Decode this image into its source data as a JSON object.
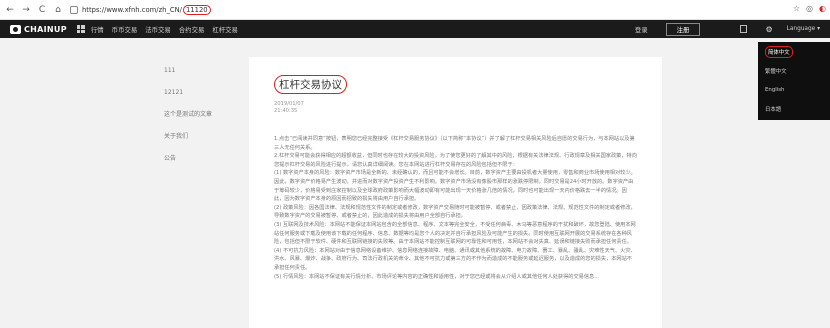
{
  "browser": {
    "nav_back": "←",
    "nav_forward": "→",
    "nav_reload": "C",
    "nav_home": "⌂",
    "url_base": "https://www.xfnh.com/zh_CN/",
    "url_id": "11120",
    "right_icons": [
      "☆",
      "◎",
      "◐"
    ],
    "accent_color": "#e01e1e"
  },
  "topnav": {
    "brand": "CHAINUP",
    "menu": [
      "行情",
      "币币交易",
      "法币交易",
      "合约交易",
      "杠杆交易"
    ],
    "login": "登录",
    "register": "注册",
    "language_label": "Language ▾"
  },
  "language_menu": {
    "items": [
      "简体中文",
      "繁體中文",
      "English",
      "日本語"
    ],
    "selected_index": 0
  },
  "sidebar": {
    "items": [
      "111",
      "12121",
      "这个是测试的文章",
      "关于我们",
      "公告"
    ]
  },
  "article": {
    "title": "杠杆交易协议",
    "date": "2019/01/07",
    "time": "21:40:35",
    "paragraphs": [
      "1.点击“已阅读并同意”按钮，表明您已经完整接受《杠杆交易服务协议》（以下简称“本协议”）并了解了杠杆交易相关风险后自愿的交易行为，与本网站以及第三人无任何关系。",
      "2.杠杆交易可能会获得相应的超额收益，但同时也存在较大的投资风险，为了使您更好的了解其中的风险，根据有关法律法规、行政规章及相关国家政策，特向您提示杠杆交易的风险进行提示，请您认真详细阅读。您在本网站进行杠杆交易存在的风险包括但不限于：",
      "(1) 数字资产本身的风险：数字资产市场是全新的、未经确认的，而且可能不会增长。目前，数字资产主要由投机者大量使用，零售和商业市场使用相对较少。因此，数字资产价格易产生波动，并进而对数字资产投资产生不利影响。数字资产市场没有像股市那样的涨跌停限制，同时交易是24小时开放的。数字资产由于筹码较少，价格易受到庄家控制以及全球政府政策影响而大幅波动即有可能出现一天价格涨几倍的情况，同时也可能出现一天内价格跌去一半的情况。因此，因为数字资产本身的原因而招致的损失将由用户自行承担。",
      "(2) 政策风险：因各国法律、法规和规范性文件的制定或者修改，数字资产交易随时可能被暂停、或者禁止，因政策法律、法规、规范性文件的制定或者修改，导致数字资产的交易被暂停、或者禁止的，因此造成的损失将由用户全部自行承担。",
      "(3) 互联网及技术风险：本网站不能保证本网站包含的全部信息、程序、文本等完全安全，不受任何病毒、木马等恶意程序的干扰和破坏，故您登陆、使用本网站任何服务或下载及使用该下载的任何程序、信息、数据等均是您个人的决定并自行承担风险及可能产生的损失。同时使用互联网开展的交易系统存在各种风险，包括但不限于软件、硬件和互联网链接的失败等。由于本网站不能控制互联网的可靠性和可用性，本网站不会对失真、延误和链接失败而承担任何责任。",
      "(4) 不可抗力风险：本网站对由于信息网络设备维护、信息网络连接故障、电脑、通讯或其他系统的故障、电力故障、罢工、暴乱、骚乱、灾难性天气、火灾、洪水、风暴、爆炸、战争、政府行为、司法行政机关的命令、其他不可抗力或第三方的不作为而造成的不能服务或延迟服务，以及造成的您的损失，本网站不承担任何责任。",
      "(5) 行情风险：本网站不保证有关行情分析、市场评论等内容的正确性和适用性，对于您已经或将会从介绍人或其他任何人处获得的交易信息..."
    ]
  }
}
